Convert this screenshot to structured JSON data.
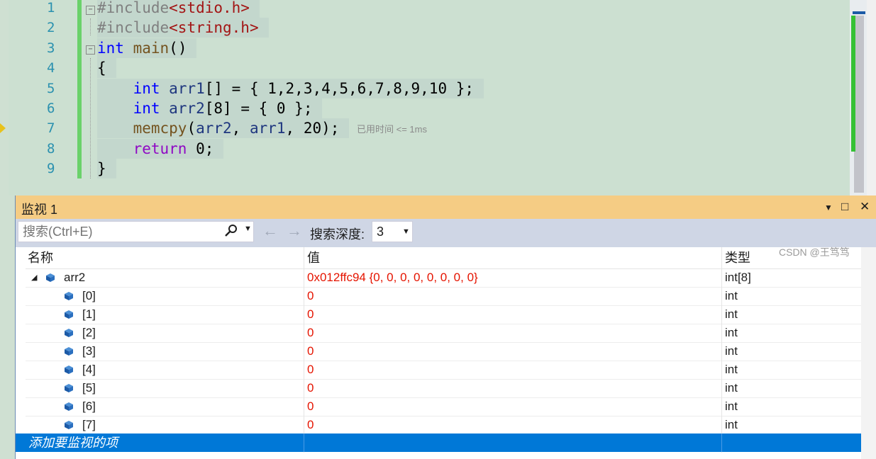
{
  "editor": {
    "lines": [
      {
        "num": "1",
        "parts": [
          {
            "t": "#include",
            "c": "pp"
          },
          {
            "t": "<stdio.h>",
            "c": "str"
          }
        ]
      },
      {
        "num": "2",
        "parts": [
          {
            "t": "#include",
            "c": "pp"
          },
          {
            "t": "<string.h>",
            "c": "str"
          }
        ]
      },
      {
        "num": "3",
        "parts": [
          {
            "t": "int",
            "c": "kw"
          },
          {
            "t": " ",
            "c": ""
          },
          {
            "t": "main",
            "c": "fn"
          },
          {
            "t": "()",
            "c": ""
          }
        ]
      },
      {
        "num": "4",
        "parts": [
          {
            "t": "{",
            "c": ""
          }
        ]
      },
      {
        "num": "5",
        "parts": [
          {
            "t": "    ",
            "c": ""
          },
          {
            "t": "int",
            "c": "kw"
          },
          {
            "t": " ",
            "c": ""
          },
          {
            "t": "arr1",
            "c": "var"
          },
          {
            "t": "[] = { 1,2,3,4,5,6,7,8,9,10 };",
            "c": ""
          }
        ]
      },
      {
        "num": "6",
        "parts": [
          {
            "t": "    ",
            "c": ""
          },
          {
            "t": "int",
            "c": "kw"
          },
          {
            "t": " ",
            "c": ""
          },
          {
            "t": "arr2",
            "c": "var"
          },
          {
            "t": "[8] = { 0 };",
            "c": ""
          }
        ]
      },
      {
        "num": "7",
        "parts": [
          {
            "t": "    ",
            "c": ""
          },
          {
            "t": "memcpy",
            "c": "fn"
          },
          {
            "t": "(",
            "c": ""
          },
          {
            "t": "arr2",
            "c": "var"
          },
          {
            "t": ", ",
            "c": ""
          },
          {
            "t": "arr1",
            "c": "var"
          },
          {
            "t": ", 20);",
            "c": ""
          }
        ]
      },
      {
        "num": "8",
        "parts": [
          {
            "t": "    ",
            "c": ""
          },
          {
            "t": "return",
            "c": "ret"
          },
          {
            "t": " 0;",
            "c": ""
          }
        ]
      },
      {
        "num": "9",
        "parts": [
          {
            "t": "}",
            "c": ""
          }
        ]
      }
    ],
    "timing_hint": "已用时间 <= 1ms"
  },
  "watch": {
    "title": "监视 1",
    "dropdown_icon": "▼",
    "maximize_icon": "□",
    "close_icon": "✕",
    "search_placeholder": "搜索(Ctrl+E)",
    "search_icon": "search-icon",
    "back_icon": "←",
    "forward_icon": "→",
    "depth_label": "搜索深度:",
    "depth_value": "3",
    "columns": {
      "name": "名称",
      "value": "值",
      "type": "类型"
    },
    "rows": [
      {
        "name": "arr2",
        "value": "0x012ffc94 {0, 0, 0, 0, 0, 0, 0, 0}",
        "type": "int[8]",
        "level": 0,
        "expanded": true
      },
      {
        "name": "[0]",
        "value": "0",
        "type": "int",
        "level": 1
      },
      {
        "name": "[1]",
        "value": "0",
        "type": "int",
        "level": 1
      },
      {
        "name": "[2]",
        "value": "0",
        "type": "int",
        "level": 1
      },
      {
        "name": "[3]",
        "value": "0",
        "type": "int",
        "level": 1
      },
      {
        "name": "[4]",
        "value": "0",
        "type": "int",
        "level": 1
      },
      {
        "name": "[5]",
        "value": "0",
        "type": "int",
        "level": 1
      },
      {
        "name": "[6]",
        "value": "0",
        "type": "int",
        "level": 1
      },
      {
        "name": "[7]",
        "value": "0",
        "type": "int",
        "level": 1
      }
    ],
    "add_item_label": "添加要监视的项"
  },
  "watermark": "CSDN @王笃笃",
  "colors": {
    "title_bar": "#f5cc84",
    "selection": "#0078d7",
    "value_changed": "#e51400",
    "editor_bg": "#cce0d1"
  }
}
